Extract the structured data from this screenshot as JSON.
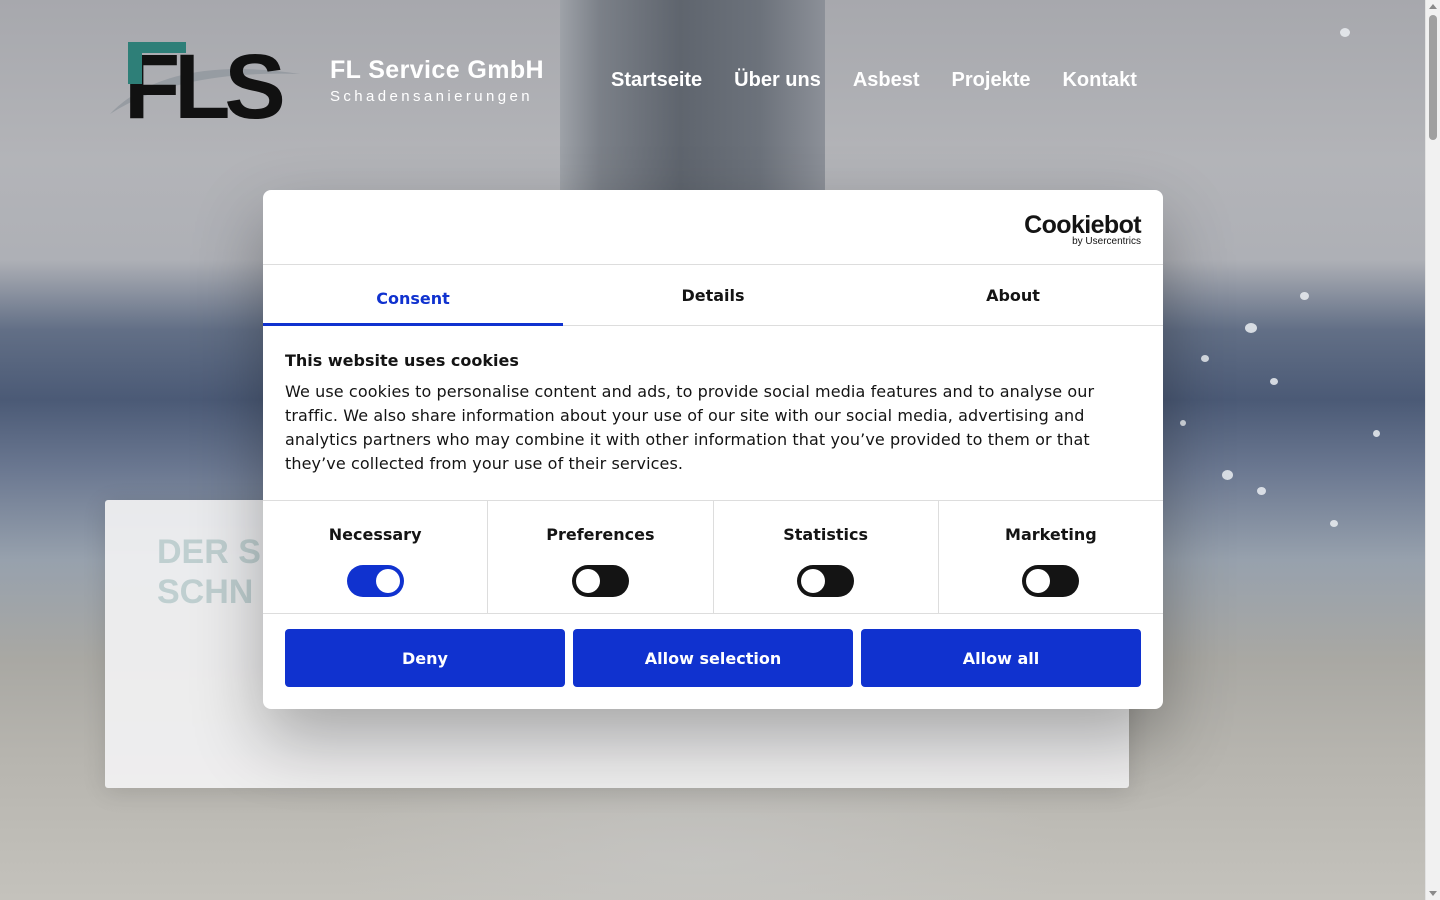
{
  "site": {
    "brand_name": "FL Service GmbH",
    "brand_tagline": "Schadensanierungen",
    "logo_text": "FLS",
    "nav": [
      {
        "label": "Startseite"
      },
      {
        "label": "Über uns"
      },
      {
        "label": "Asbest"
      },
      {
        "label": "Projekte"
      },
      {
        "label": "Kontakt"
      }
    ],
    "hero_heading_line1": "DER S",
    "hero_heading_line2": "SCHN"
  },
  "cookie_dialog": {
    "provider_logo": "Cookiebot",
    "provider_sub": "by Usercentrics",
    "tabs": [
      {
        "label": "Consent",
        "active": true
      },
      {
        "label": "Details",
        "active": false
      },
      {
        "label": "About",
        "active": false
      }
    ],
    "title": "This website uses cookies",
    "body": "We use cookies to personalise content and ads, to provide social media features and to analyse our traffic. We also share information about your use of our site with our social media, advertising and analytics partners who may combine it with other information that you’ve provided to them or that they’ve collected from your use of their services.",
    "categories": [
      {
        "label": "Necessary",
        "enabled": true
      },
      {
        "label": "Preferences",
        "enabled": false
      },
      {
        "label": "Statistics",
        "enabled": false
      },
      {
        "label": "Marketing",
        "enabled": false
      }
    ],
    "buttons": {
      "deny": "Deny",
      "allow_selection": "Allow selection",
      "allow_all": "Allow all"
    }
  },
  "colors": {
    "accent": "#1032cf",
    "logo_teal": "#2e7f78",
    "logo_dark": "#111111"
  }
}
